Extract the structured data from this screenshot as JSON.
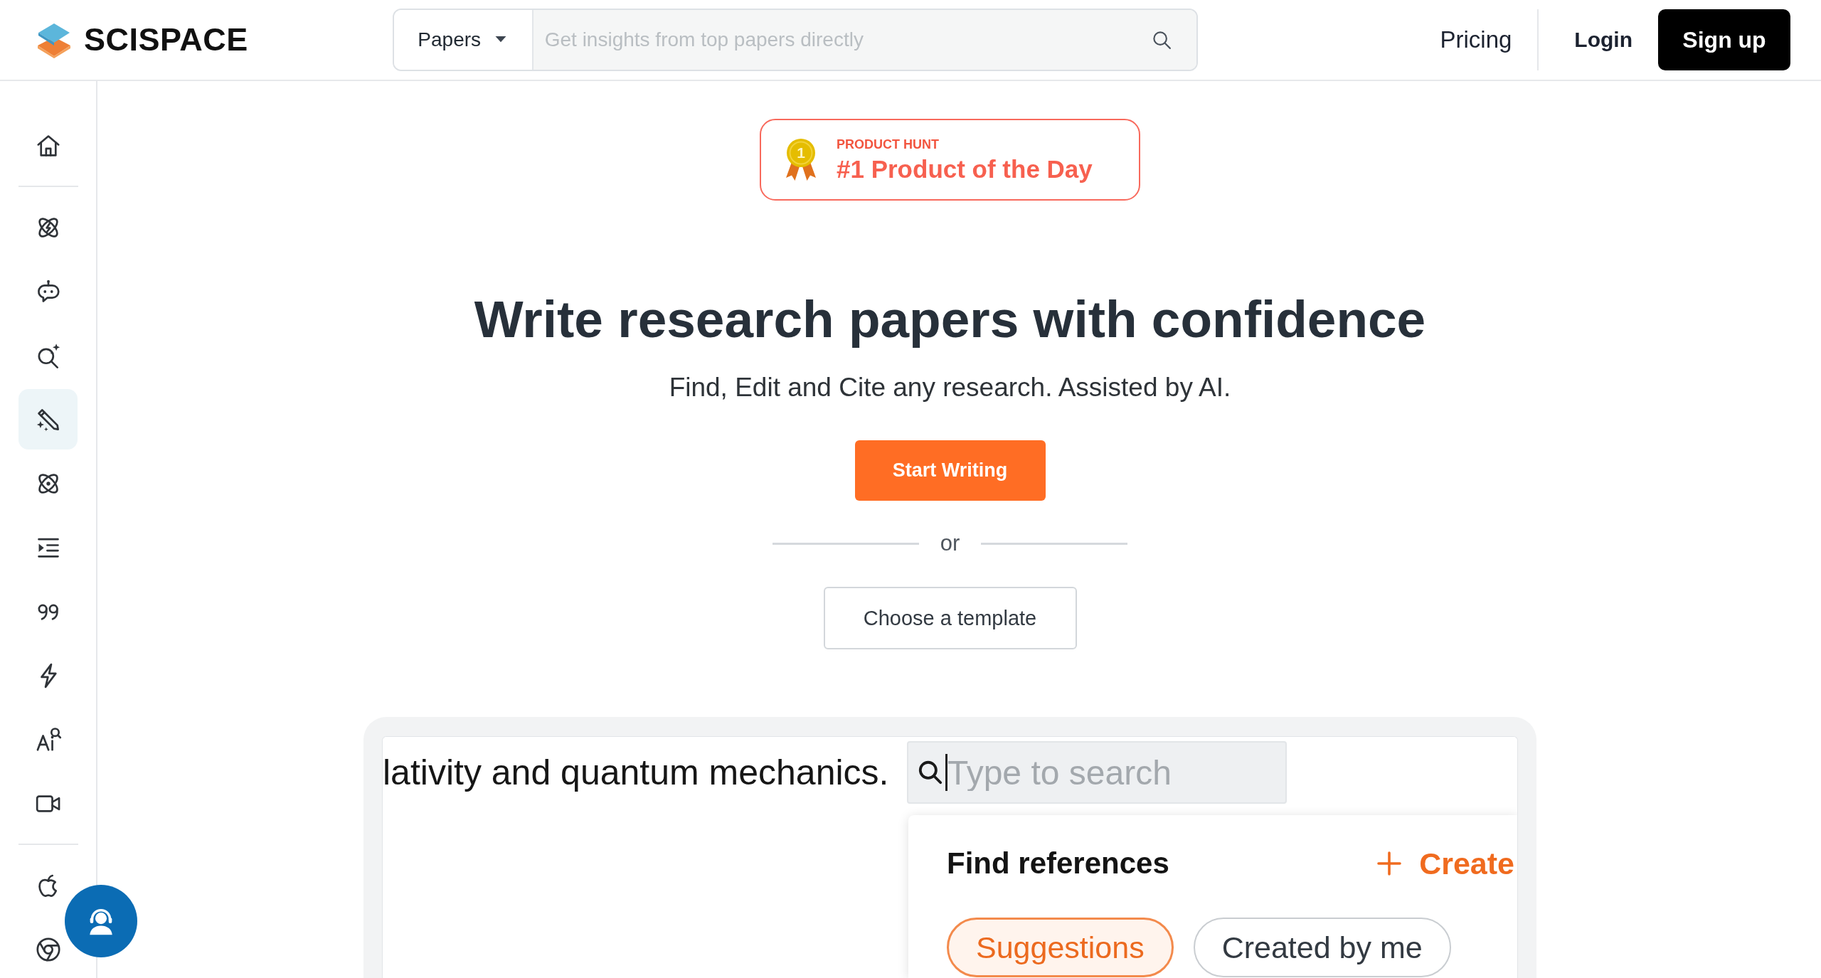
{
  "header": {
    "logo": "SCISPACE",
    "search": {
      "scope": "Papers",
      "placeholder": "Get insights from top papers directly"
    },
    "nav": [
      {
        "label": "Pricing",
        "kind": "link"
      },
      {
        "label": "Login",
        "kind": "account"
      },
      {
        "label": "Sign up",
        "kind": "primary"
      }
    ]
  },
  "sidebar": {
    "groups": [
      {
        "items": [
          {
            "selected": false
          }
        ]
      },
      {
        "items": [
          {
            "selected": false
          },
          {
            "selected": false
          },
          {
            "selected": false
          },
          {
            "selected": true
          },
          {
            "selected": false
          },
          {
            "selected": false
          },
          {
            "selected": false
          },
          {
            "selected": false
          },
          {
            "selected": false
          },
          {
            "selected": false
          }
        ]
      },
      {
        "items": [
          {
            "selected": false
          },
          {
            "selected": false
          }
        ]
      }
    ]
  },
  "badge": {
    "medal": "1",
    "eyebrow": "PRODUCT HUNT",
    "title": "#1 Product of the Day"
  },
  "hero": {
    "title": "Write research papers with confidence",
    "subtitle": "Find, Edit and Cite any research. Assisted by AI.",
    "primary_action": "Start Writing",
    "separator": "or",
    "secondary_action": "Choose a template"
  },
  "preview": {
    "editor_text": "lativity and quantum mechanics.",
    "search": {
      "placeholder": "Type to search"
    },
    "references": {
      "title": "Find references",
      "action": "Create",
      "tabs": [
        {
          "label": "Suggestions",
          "selected": true
        },
        {
          "label": "Created by me",
          "selected": false
        }
      ]
    }
  }
}
